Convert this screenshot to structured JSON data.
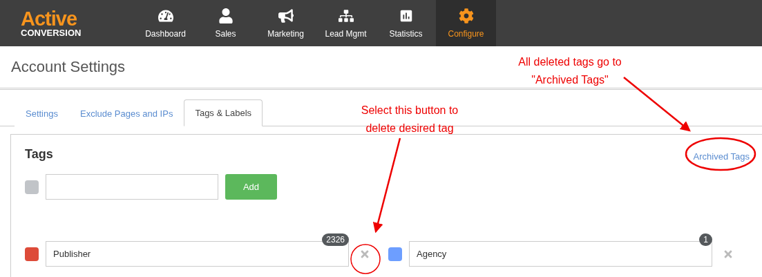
{
  "logo": {
    "line1": "Active",
    "line2": "CONVERSION"
  },
  "nav": [
    {
      "label": "Dashboard",
      "selected": false
    },
    {
      "label": "Sales",
      "selected": false
    },
    {
      "label": "Marketing",
      "selected": false
    },
    {
      "label": "Lead Mgmt",
      "selected": false
    },
    {
      "label": "Statistics",
      "selected": false
    },
    {
      "label": "Configure",
      "selected": true
    }
  ],
  "page_title": "Account Settings",
  "tabs": [
    {
      "label": "Settings",
      "selected": false
    },
    {
      "label": "Exclude Pages and IPs",
      "selected": false
    },
    {
      "label": "Tags & Labels",
      "selected": true
    }
  ],
  "panel": {
    "title": "Tags",
    "archived_link": "Archived Tags",
    "new_tag": {
      "color": "#c1c4c8",
      "add_button": "Add"
    },
    "tags": [
      {
        "name": "Publisher",
        "count": "2326",
        "color": "#dd4b39"
      },
      {
        "name": "Agency",
        "count": "1",
        "color": "#6d9eff"
      }
    ]
  },
  "annotations": [
    {
      "lines": [
        "Select this button to",
        "delete desired tag"
      ]
    },
    {
      "lines": [
        "All deleted tags go to",
        "\"Archived Tags\""
      ]
    }
  ]
}
